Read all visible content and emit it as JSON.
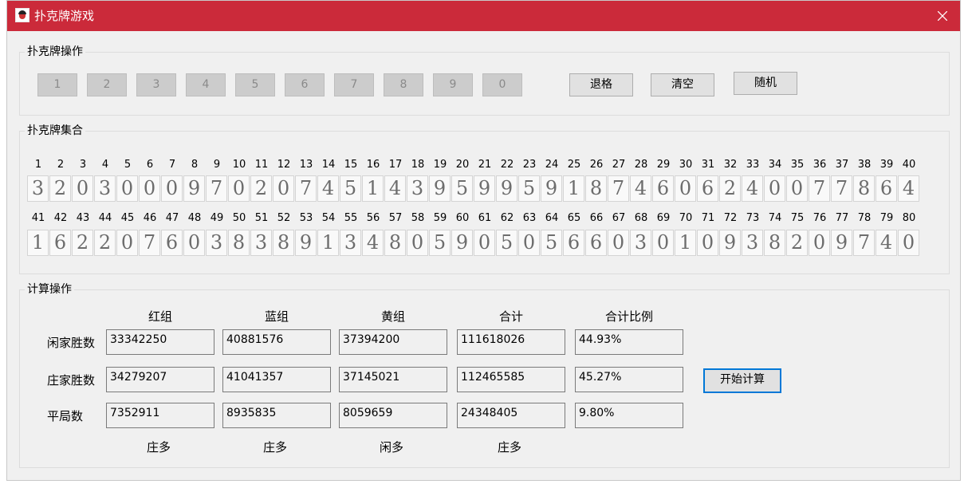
{
  "window": {
    "title": "扑克牌游戏"
  },
  "ops": {
    "legend": "扑克牌操作",
    "digit_buttons": [
      "1",
      "2",
      "3",
      "4",
      "5",
      "6",
      "7",
      "8",
      "9",
      "0"
    ],
    "backspace": "退格",
    "clear": "清空",
    "random": "随机"
  },
  "collection": {
    "legend": "扑克牌集合",
    "indices": [
      "1",
      "2",
      "3",
      "4",
      "5",
      "6",
      "7",
      "8",
      "9",
      "10",
      "11",
      "12",
      "13",
      "14",
      "15",
      "16",
      "17",
      "18",
      "19",
      "20",
      "21",
      "22",
      "23",
      "24",
      "25",
      "26",
      "27",
      "28",
      "29",
      "30",
      "31",
      "32",
      "33",
      "34",
      "35",
      "36",
      "37",
      "38",
      "39",
      "40",
      "41",
      "42",
      "43",
      "44",
      "45",
      "46",
      "47",
      "48",
      "49",
      "50",
      "51",
      "52",
      "53",
      "54",
      "55",
      "56",
      "57",
      "58",
      "59",
      "60",
      "61",
      "62",
      "63",
      "64",
      "65",
      "66",
      "67",
      "68",
      "69",
      "70",
      "71",
      "72",
      "73",
      "74",
      "75",
      "76",
      "77",
      "78",
      "79",
      "80"
    ],
    "cards": [
      "3",
      "2",
      "0",
      "3",
      "0",
      "0",
      "0",
      "9",
      "7",
      "0",
      "2",
      "0",
      "7",
      "4",
      "5",
      "1",
      "4",
      "3",
      "9",
      "5",
      "9",
      "9",
      "5",
      "9",
      "1",
      "8",
      "7",
      "4",
      "6",
      "0",
      "6",
      "2",
      "4",
      "0",
      "0",
      "7",
      "7",
      "8",
      "6",
      "4",
      "1",
      "6",
      "2",
      "2",
      "0",
      "7",
      "6",
      "0",
      "3",
      "8",
      "3",
      "8",
      "9",
      "1",
      "3",
      "4",
      "8",
      "0",
      "5",
      "9",
      "0",
      "5",
      "0",
      "5",
      "6",
      "6",
      "0",
      "3",
      "0",
      "1",
      "0",
      "9",
      "3",
      "8",
      "2",
      "0",
      "9",
      "7",
      "4",
      "0"
    ]
  },
  "calc": {
    "legend": "计算操作",
    "headers": [
      "红组",
      "蓝组",
      "黄组",
      "合计",
      "合计比例"
    ],
    "rows": [
      {
        "label": "闲家胜数",
        "values": [
          "33342250",
          "40881576",
          "37394200",
          "111618026",
          "44.93%"
        ]
      },
      {
        "label": "庄家胜数",
        "values": [
          "34279207",
          "41041357",
          "37145021",
          "112465585",
          "45.27%"
        ]
      },
      {
        "label": "平局数",
        "values": [
          "7352911",
          "8935835",
          "8059659",
          "24348405",
          "9.80%"
        ]
      }
    ],
    "footer": [
      "庄多",
      "庄多",
      "闲多",
      "庄多"
    ],
    "start_button": "开始计算"
  }
}
